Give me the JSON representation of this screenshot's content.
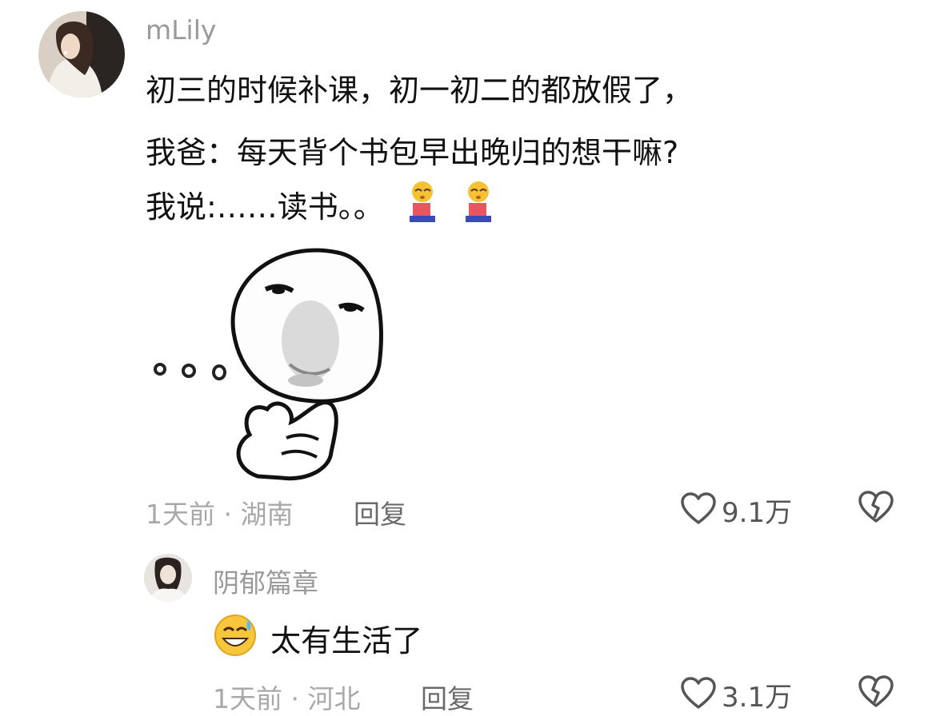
{
  "comments": [
    {
      "username": "mLily",
      "lines": [
        "初三的时候补课，初一初二的都放假了，",
        "我爸：每天背个书包早出晚归的想干嘛?",
        "我说:……读书。。"
      ],
      "time": "1天前",
      "location": "湖南",
      "reply_label": "回复",
      "likes": "9.1万",
      "icons": [
        "kneeling-person-emoji",
        "kneeling-person-emoji",
        "thinking-face-sticker",
        "heart-outline-icon",
        "broken-heart-icon"
      ]
    },
    {
      "username": "阴郁篇章",
      "text": "太有生活了",
      "time": "1天前",
      "location": "河北",
      "reply_label": "回复",
      "likes": "3.1万",
      "icons": [
        "grinning-sweat-emoji",
        "heart-outline-icon",
        "broken-heart-icon"
      ]
    }
  ],
  "separator": "·"
}
